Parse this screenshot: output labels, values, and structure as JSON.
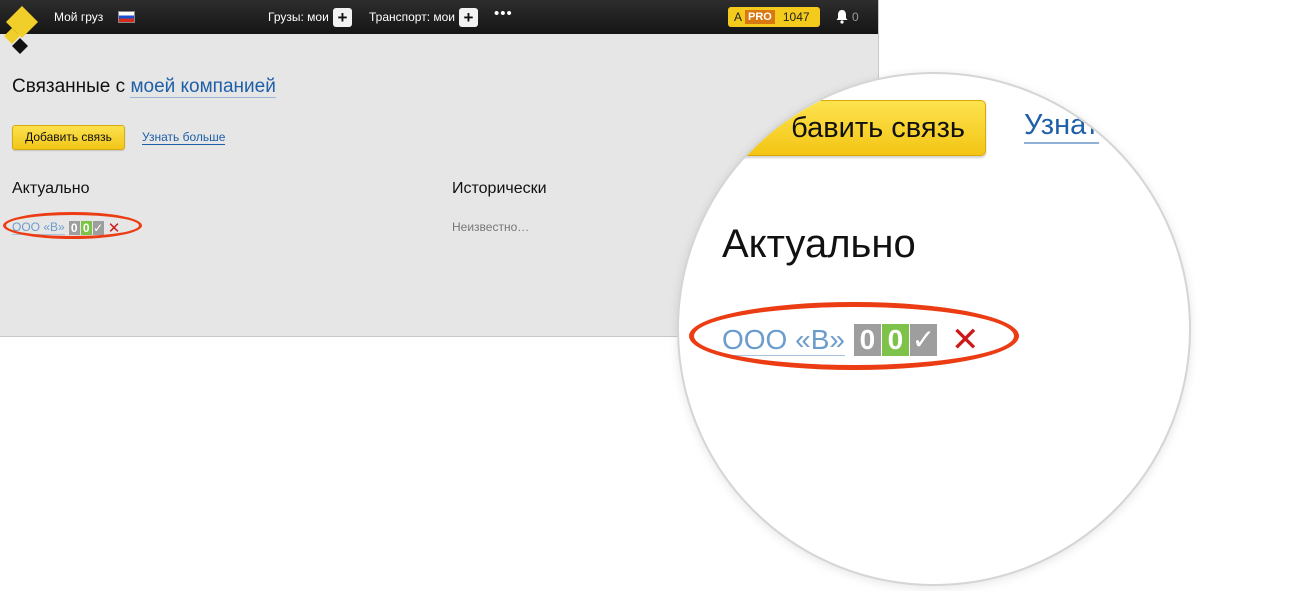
{
  "topbar": {
    "my_cargo": "Мой груз",
    "cargo_mine": "Грузы: мои",
    "transport_mine": "Транспорт: мои",
    "plus": "+",
    "more": "•••",
    "badge_letter": "A",
    "badge_pro": "PRO",
    "badge_count": "1047",
    "notif_count": "0"
  },
  "page": {
    "title_prefix": "Связанные с",
    "title_link": "моей компанией",
    "add_button": "Добавить связь",
    "learn_more": "Узнать больше",
    "col_current": "Актуально",
    "col_history": "Исторически",
    "history_empty": "Неизвестно…"
  },
  "relation": {
    "company": "ООО «В»",
    "count_a": "0",
    "count_b": "0",
    "check": "✓",
    "remove": "✕"
  },
  "zoom": {
    "button_fragment": "бавить связь",
    "learn_fragment": "Узнат",
    "heading": "Актуально"
  },
  "colors": {
    "accent_yellow": "#f4cb1d",
    "link_blue": "#1e5fa8",
    "highlight_red": "#ec3c13",
    "count_green": "#7ec24a"
  }
}
